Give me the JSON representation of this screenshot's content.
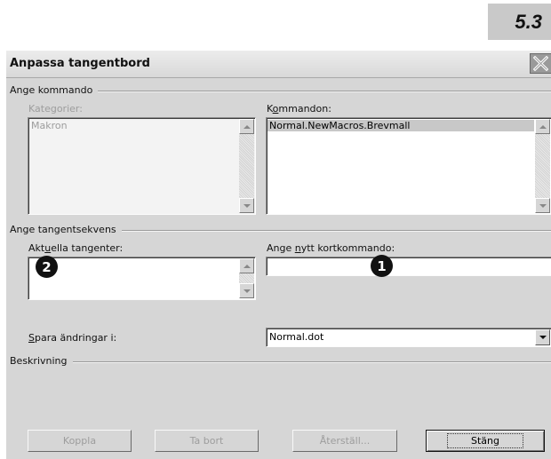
{
  "section_number": "5.3",
  "dialog": {
    "title": "Anpassa tangentbord",
    "close_icon": "close-icon"
  },
  "groups": {
    "command": "Ange kommando",
    "key_sequence": "Ange tangentsekvens",
    "description": "Beskrivning"
  },
  "categories": {
    "label": "Kategorier:",
    "items": [
      "Makron"
    ],
    "enabled": false
  },
  "commands": {
    "label_pre": "K",
    "label_mnemonic": "o",
    "label_post": "mmandon:",
    "items": [
      "Normal.NewMacros.Brevmall"
    ],
    "selected_index": 0
  },
  "current_keys": {
    "label_pre": "Akt",
    "label_mnemonic": "u",
    "label_post": "ella tangenter:",
    "value": ""
  },
  "new_shortcut": {
    "label_pre": "Ange ",
    "label_mnemonic": "n",
    "label_post": "ytt kortkommando:",
    "value": ""
  },
  "save_in": {
    "label_mnemonic": "S",
    "label_post": "para ändringar i:",
    "value": "Normal.dot"
  },
  "callouts": {
    "one": "1",
    "two": "2"
  },
  "buttons": {
    "assign": "Koppla",
    "remove": "Ta bort",
    "reset": "Återställ...",
    "close": "Stäng"
  },
  "colors": {
    "dialog_bg": "#d6d6d6",
    "selection": "#c8c8c8",
    "disabled_text": "#9d9d9d",
    "badge": "#111111"
  }
}
